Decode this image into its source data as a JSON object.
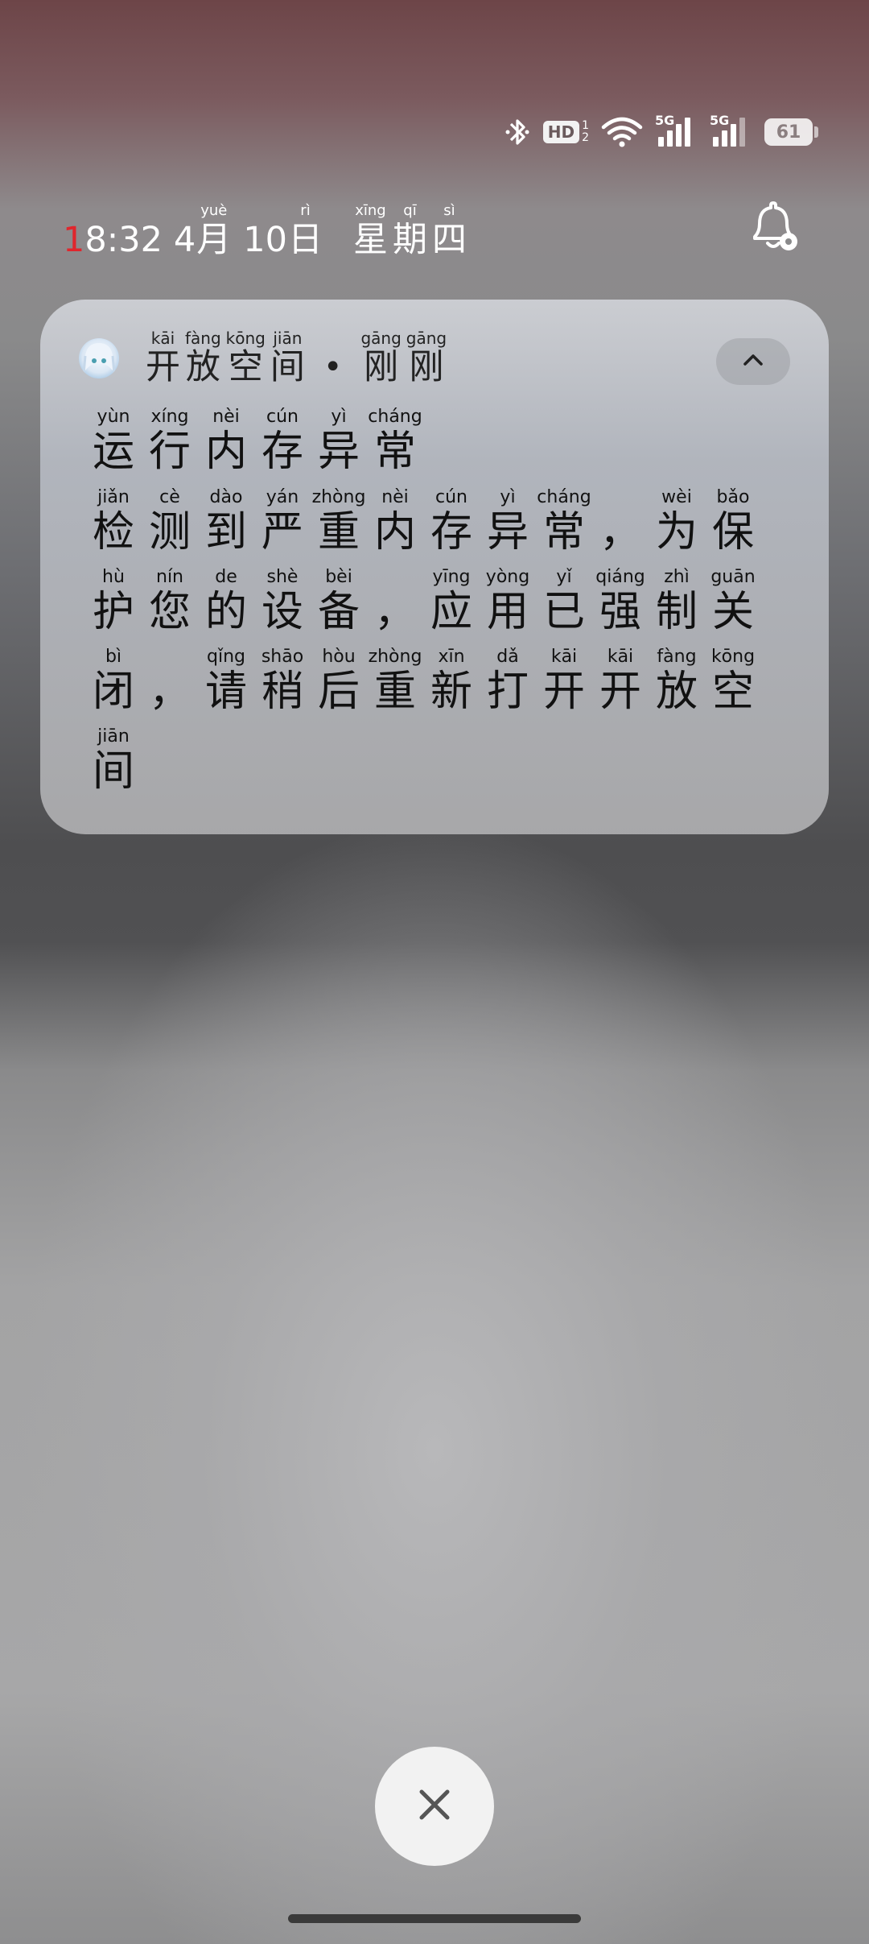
{
  "status_bar": {
    "bluetooth_icon": "bluetooth-icon",
    "hd_label": "HD",
    "hd_sub_1": "1",
    "hd_sub_2": "2",
    "signal_1_label": "5G",
    "signal_2_label": "5G",
    "battery_level": "61"
  },
  "clock": {
    "time_first": "1",
    "time_rest": "8:32",
    "month_num": "4",
    "month_char": "月",
    "month_py": "yuè",
    "day_num": "10",
    "day_char": "日",
    "day_py": "rì",
    "weekday": [
      {
        "hz": "星",
        "py": "xīng"
      },
      {
        "hz": "期",
        "py": "qī"
      },
      {
        "hz": "四",
        "py": "sì"
      }
    ]
  },
  "notification": {
    "app_name": [
      {
        "hz": "开",
        "py": "kāi"
      },
      {
        "hz": "放",
        "py": "fàng"
      },
      {
        "hz": "空",
        "py": "kōng"
      },
      {
        "hz": "间",
        "py": "jiān"
      }
    ],
    "separator": "•",
    "time_ago": [
      {
        "hz": "刚",
        "py": "gāng"
      },
      {
        "hz": "刚",
        "py": "gāng"
      }
    ],
    "title": [
      {
        "hz": "运",
        "py": "yùn"
      },
      {
        "hz": "行",
        "py": "xíng"
      },
      {
        "hz": "内",
        "py": "nèi"
      },
      {
        "hz": "存",
        "py": "cún"
      },
      {
        "hz": "异",
        "py": "yì"
      },
      {
        "hz": "常",
        "py": "cháng"
      }
    ],
    "body_lines": [
      [
        {
          "hz": "检",
          "py": "jiǎn"
        },
        {
          "hz": "测",
          "py": "cè"
        },
        {
          "hz": "到",
          "py": "dào"
        },
        {
          "hz": "严",
          "py": "yán"
        },
        {
          "hz": "重",
          "py": "zhòng"
        },
        {
          "hz": "内",
          "py": "nèi"
        },
        {
          "hz": "存",
          "py": "cún"
        },
        {
          "hz": "异",
          "py": "yì"
        },
        {
          "hz": "常",
          "py": "cháng"
        },
        {
          "hz": "，",
          "py": ""
        },
        {
          "hz": "为",
          "py": "wèi"
        },
        {
          "hz": "保",
          "py": "bǎo"
        }
      ],
      [
        {
          "hz": "护",
          "py": "hù"
        },
        {
          "hz": "您",
          "py": "nín"
        },
        {
          "hz": "的",
          "py": "de"
        },
        {
          "hz": "设",
          "py": "shè"
        },
        {
          "hz": "备",
          "py": "bèi"
        },
        {
          "hz": "，",
          "py": ""
        },
        {
          "hz": "应",
          "py": "yīng"
        },
        {
          "hz": "用",
          "py": "yòng"
        },
        {
          "hz": "已",
          "py": "yǐ"
        },
        {
          "hz": "强",
          "py": "qiáng"
        },
        {
          "hz": "制",
          "py": "zhì"
        },
        {
          "hz": "关",
          "py": "guān"
        }
      ],
      [
        {
          "hz": "闭",
          "py": "bì"
        },
        {
          "hz": "，",
          "py": ""
        },
        {
          "hz": "请",
          "py": "qǐng"
        },
        {
          "hz": "稍",
          "py": "shāo"
        },
        {
          "hz": "后",
          "py": "hòu"
        },
        {
          "hz": "重",
          "py": "zhòng"
        },
        {
          "hz": "新",
          "py": "xīn"
        },
        {
          "hz": "打",
          "py": "dǎ"
        },
        {
          "hz": "开",
          "py": "kāi"
        },
        {
          "hz": "开",
          "py": "kāi"
        },
        {
          "hz": "放",
          "py": "fàng"
        },
        {
          "hz": "空",
          "py": "kōng"
        }
      ],
      [
        {
          "hz": "间",
          "py": "jiān"
        }
      ]
    ],
    "collapse_icon": "chevron-up-icon"
  },
  "controls": {
    "dismiss_icon": "close-icon",
    "bell_icon": "notification-settings-icon"
  },
  "colors": {
    "time_accent": "#e0262d",
    "card_bg": "#c8cacf"
  }
}
